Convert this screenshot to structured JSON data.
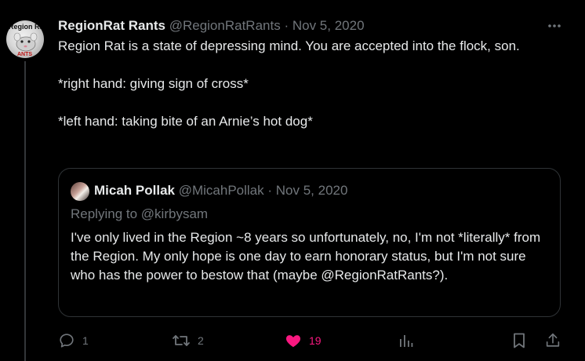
{
  "tweet": {
    "author_name": "RegionRat Rants",
    "author_handle": "@RegionRatRants",
    "separator": "·",
    "date": "Nov 5, 2020",
    "avatar_text_top": "Region Ra",
    "avatar_text_bottom": "ANTS",
    "body": [
      "Region Rat is a state of depressing mind. You are accepted into the flock, son.",
      "*right hand: giving sign of cross*",
      "*left hand: taking bite of an Arnie’s hot dog*"
    ]
  },
  "quote": {
    "author_name": "Micah Pollak",
    "author_handle": "@MicahPollak",
    "separator": "·",
    "date": "Nov 5, 2020",
    "replying_prefix": "Replying to",
    "replying_to": "@kirbysam",
    "body": "I've only lived in the Region ~8 years so unfortunately, no, I'm not *literally* from the Region. My only hope is one day to earn honorary status, but I'm not sure who has the power to bestow that (maybe @RegionRatRants?)."
  },
  "actions": {
    "reply_count": "1",
    "retweet_count": "2",
    "like_count": "19"
  },
  "colors": {
    "background": "#000000",
    "text": "#e7e9ea",
    "muted": "#71767b",
    "like": "#f91880",
    "border": "#2f3336"
  },
  "icons": [
    "more-icon",
    "reply-icon",
    "retweet-icon",
    "heart-icon",
    "views-icon",
    "bookmark-icon",
    "share-icon"
  ]
}
